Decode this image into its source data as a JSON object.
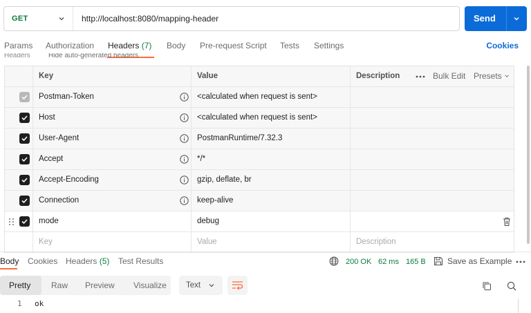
{
  "request": {
    "method": "GET",
    "url": "http://localhost:8080/mapping-header",
    "send_label": "Send"
  },
  "request_tabs": [
    {
      "label": "Params"
    },
    {
      "label": "Authorization"
    },
    {
      "label": "Headers",
      "count": "(7)"
    },
    {
      "label": "Body"
    },
    {
      "label": "Pre-request Script"
    },
    {
      "label": "Tests"
    },
    {
      "label": "Settings"
    }
  ],
  "cookies_label": "Cookies",
  "headers_section": {
    "title": "Headers",
    "toggle_label": "Hide auto-generated headers"
  },
  "headers_table": {
    "columns": {
      "key": "Key",
      "value": "Value",
      "description": "Description"
    },
    "bulk_edit": "Bulk Edit",
    "presets": "Presets",
    "rows": [
      {
        "key": "Postman-Token",
        "value": "<calculated when request is sent>",
        "checked": true,
        "locked": true
      },
      {
        "key": "Host",
        "value": "<calculated when request is sent>",
        "checked": true
      },
      {
        "key": "User-Agent",
        "value": "PostmanRuntime/7.32.3",
        "checked": true
      },
      {
        "key": "Accept",
        "value": "*/*",
        "checked": true
      },
      {
        "key": "Accept-Encoding",
        "value": "gzip, deflate, br",
        "checked": true
      },
      {
        "key": "Connection",
        "value": "keep-alive",
        "checked": true
      },
      {
        "key": "mode",
        "value": "debug",
        "checked": true
      }
    ],
    "new_row": {
      "key_placeholder": "Key",
      "value_placeholder": "Value",
      "description_placeholder": "Description"
    }
  },
  "response": {
    "tabs": [
      {
        "label": "Body"
      },
      {
        "label": "Cookies"
      },
      {
        "label": "Headers",
        "count": "(5)"
      },
      {
        "label": "Test Results"
      }
    ],
    "status": "200 OK",
    "time": "62 ms",
    "size": "165 B",
    "save_example": "Save as Example",
    "formats": [
      "Pretty",
      "Raw",
      "Preview",
      "Visualize"
    ],
    "text_format": "Text",
    "body_lines": [
      {
        "no": "1",
        "text": "ok"
      }
    ]
  },
  "colors": {
    "accent": "#0b6bd8",
    "method_get": "#0a7c3e",
    "status_ok": "#0a7c3e",
    "tab_underline": "#ff6c37"
  }
}
